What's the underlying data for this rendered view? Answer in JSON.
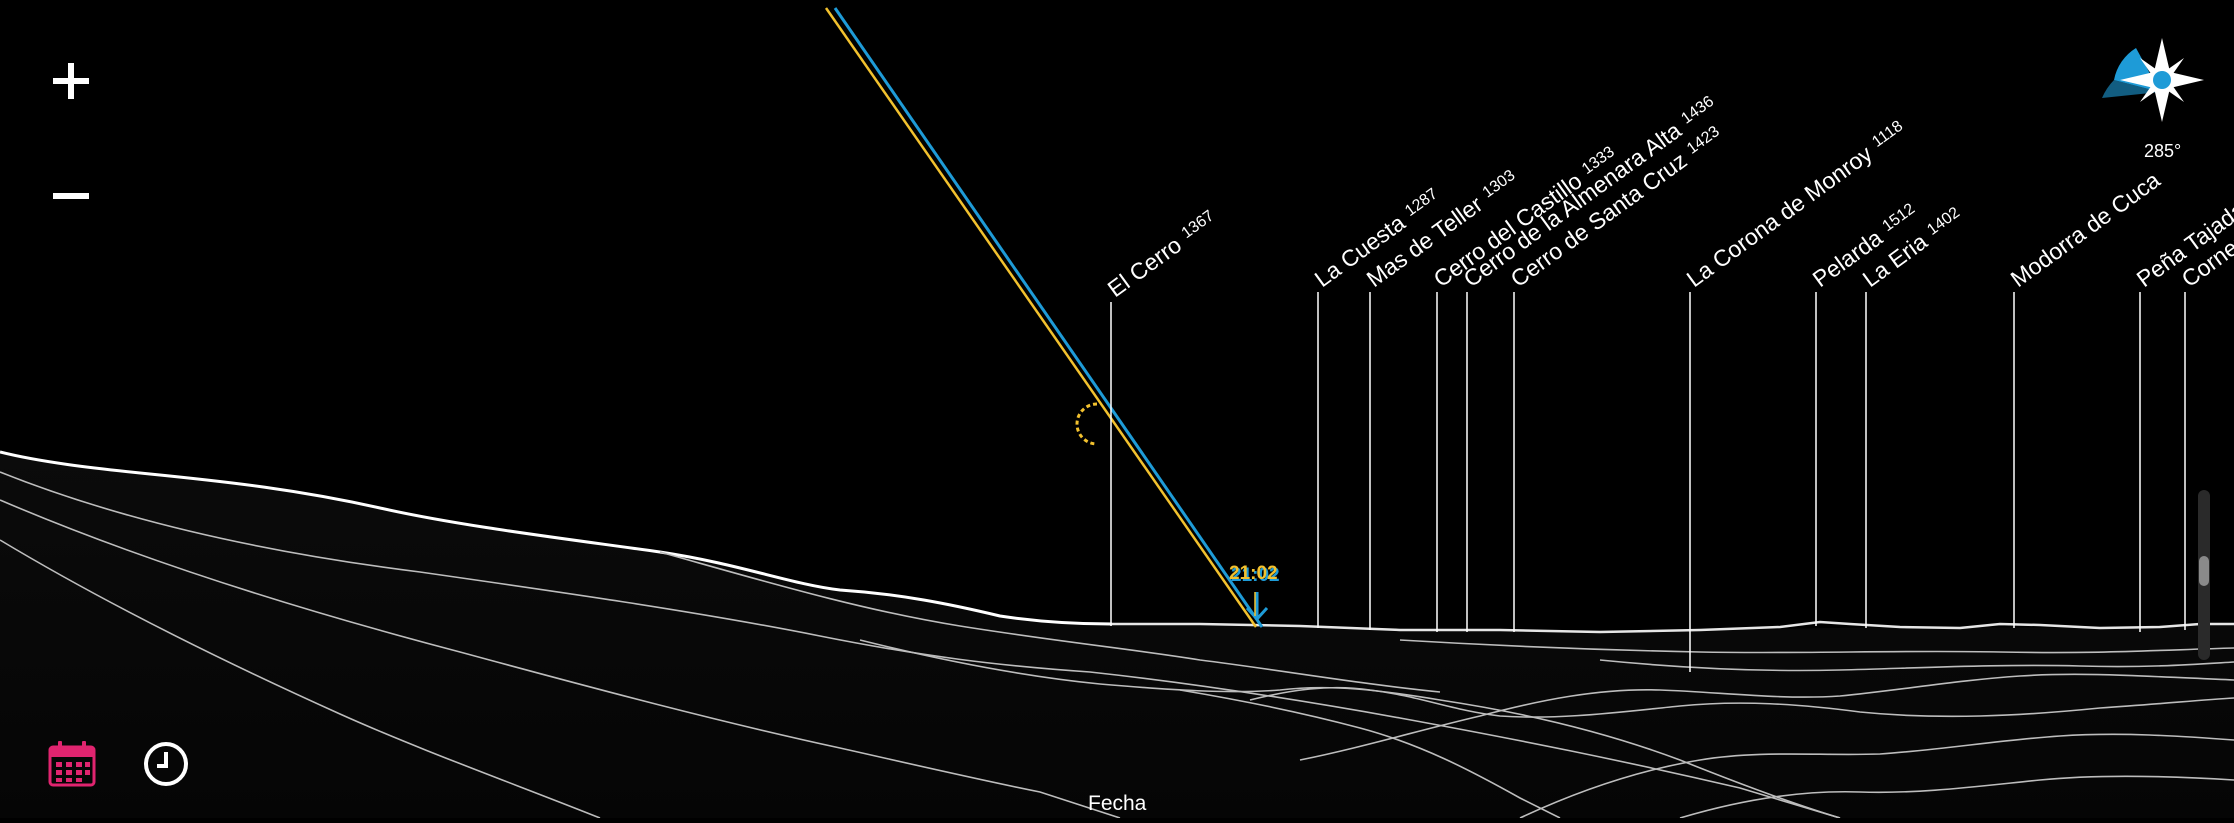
{
  "zoom": {
    "in_label": "+",
    "out_label": "−"
  },
  "peaks": [
    {
      "name": "El Cerro",
      "elevation": "1367"
    },
    {
      "name": "La Cuesta",
      "elevation": "1287"
    },
    {
      "name": "Mas de Teller",
      "elevation": "1303"
    },
    {
      "name": "Cerro del Castillo",
      "elevation": "1333"
    },
    {
      "name": "Cerro de la Almenara Alta",
      "elevation": "1436"
    },
    {
      "name": "Cerro de Santa Cruz",
      "elevation": "1423"
    },
    {
      "name": "La Corona de Monroy",
      "elevation": "1118"
    },
    {
      "name": "Pelarda",
      "elevation": "1512"
    },
    {
      "name": "La Eria",
      "elevation": "1402"
    },
    {
      "name": "Modorra de Cuca",
      "elevation": ""
    },
    {
      "name": "Peña Tajada",
      "elevation": ""
    },
    {
      "name": "Cornen",
      "elevation": ""
    }
  ],
  "sunset": {
    "time": "21:02"
  },
  "compass": {
    "heading": "285°"
  },
  "toolbar": {
    "mode_label": "Fecha"
  },
  "icons": {
    "zoom_in": "plus-icon",
    "zoom_out": "minus-icon",
    "calendar": "calendar-icon",
    "clock": "clock-icon",
    "compass": "compass-rose-icon",
    "sunset_marker": "arrow-down-icon"
  },
  "colors": {
    "background": "#000000",
    "sun_path_blue": "#1e9bd7",
    "sun_path_yellow": "#f2c12e",
    "time_label": "#f2c12e",
    "calendar_accent": "#e0246f",
    "compass_sector": "#1e9bd7"
  }
}
